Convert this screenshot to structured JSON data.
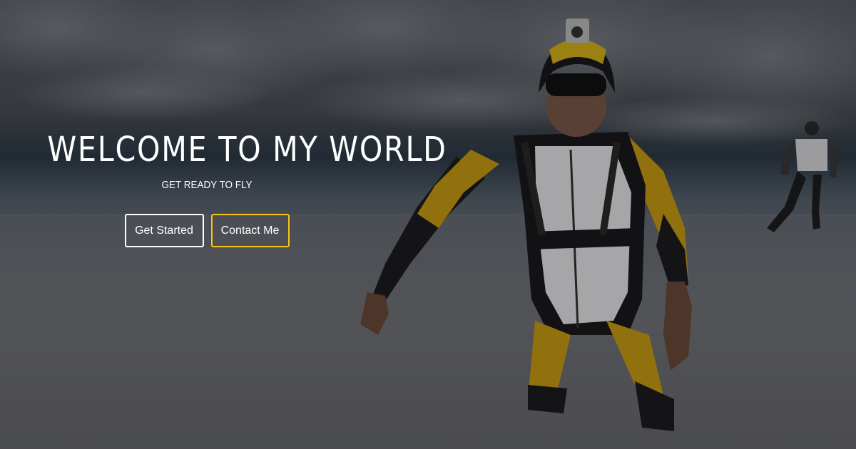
{
  "hero": {
    "title": "WELCOME TO MY WORLD",
    "subtitle": "GET READY TO FLY",
    "buttons": {
      "primary_label": "Get Started",
      "secondary_label": "Contact Me"
    }
  },
  "colors": {
    "accent": "#f5c518",
    "text": "#ffffff",
    "overlay": "rgba(0,0,0,0.28)"
  },
  "background": {
    "subject": "skydivers in freefall above clouds",
    "suit_colors": [
      "#e0b020",
      "#f0f0f0",
      "#222222"
    ]
  }
}
